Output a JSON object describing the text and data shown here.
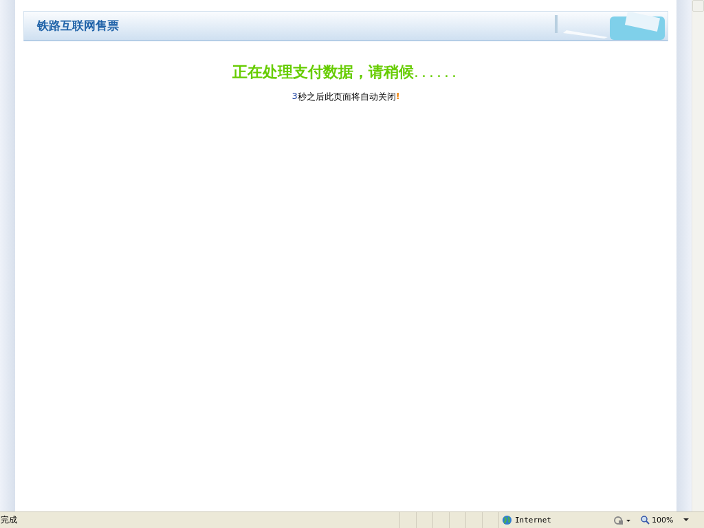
{
  "header": {
    "title": "铁路互联网售票"
  },
  "message": {
    "heading": "正在处理支付数据，请稍候",
    "dots": "......",
    "countdown": "3",
    "notice": "秒之后此页面将自动关闭",
    "exclamation": "!"
  },
  "status_bar": {
    "status": "完成",
    "zone": "Internet",
    "zoom": "100%"
  }
}
